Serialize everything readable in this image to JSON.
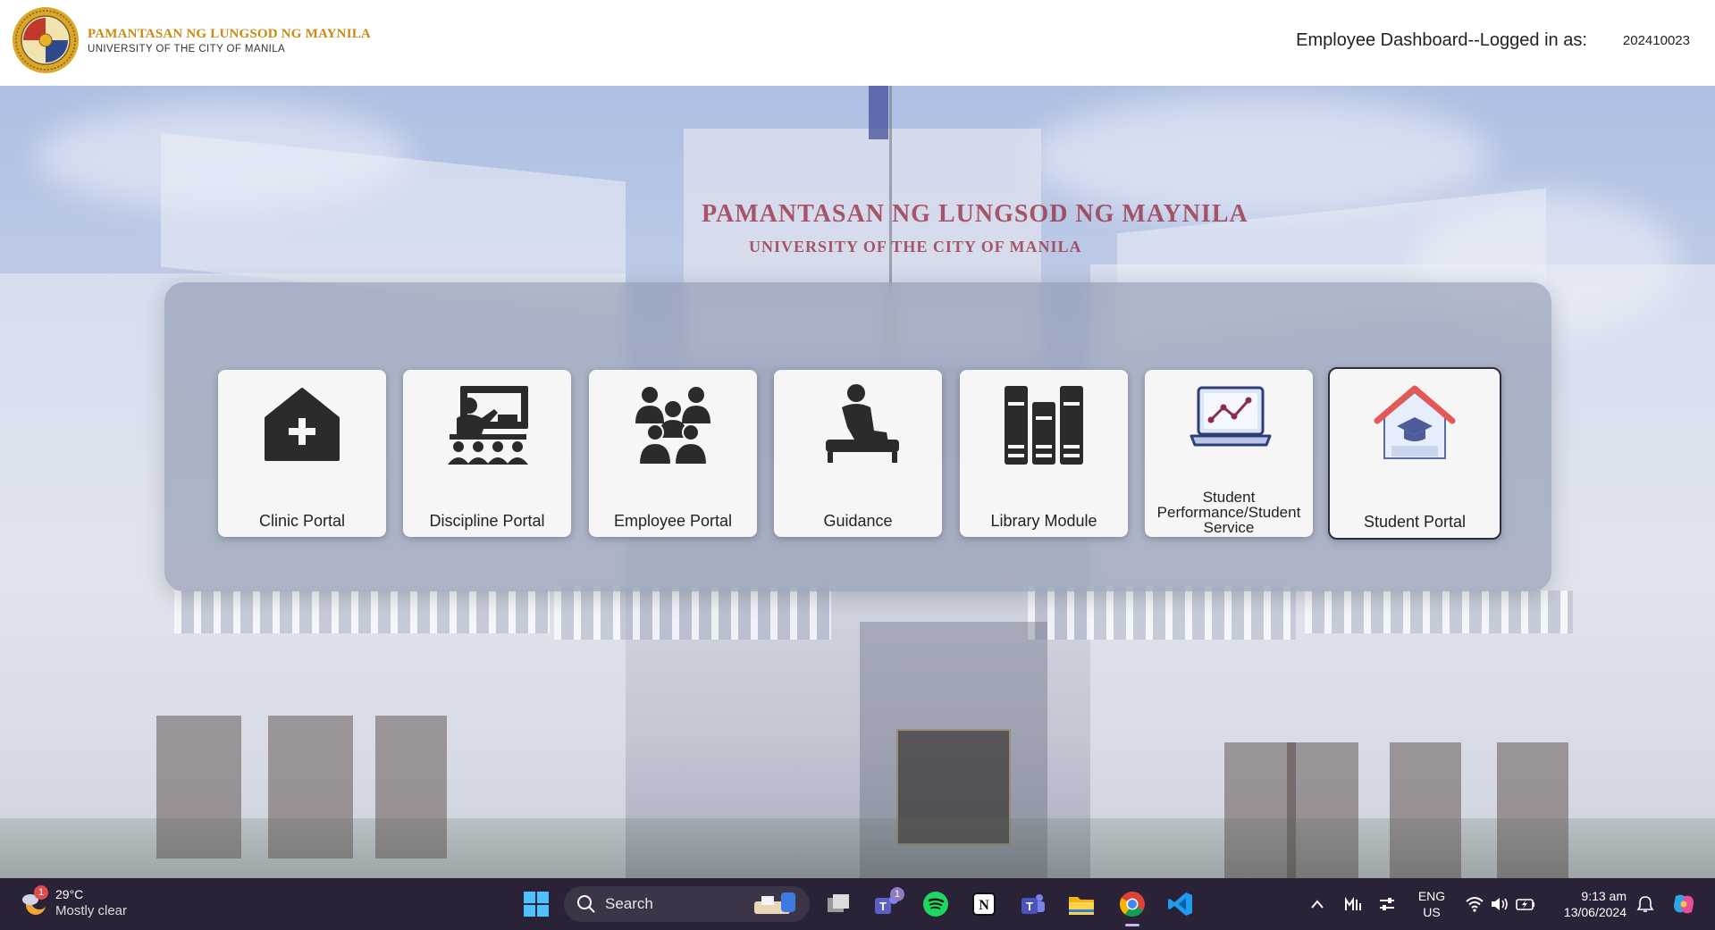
{
  "header": {
    "logo_title": "PAMANTASAN NG LUNGSOD NG MAYNILA",
    "logo_subtitle": "UNIVERSITY OF THE CITY OF MANILA",
    "dashboard_label": "Employee Dashboard--Logged in as:",
    "user_id": "202410023"
  },
  "background": {
    "sign_line1": "PAMANTASAN NG LUNGSOD NG MAYNILA",
    "sign_line2": "UNIVERSITY OF THE CITY OF MANILA"
  },
  "portals": [
    {
      "label": "Clinic Portal",
      "icon": "clinic-house-plus-icon"
    },
    {
      "label": "Discipline Portal",
      "icon": "teacher-classroom-icon"
    },
    {
      "label": "Employee Portal",
      "icon": "people-group-icon"
    },
    {
      "label": "Guidance",
      "icon": "seated-person-icon"
    },
    {
      "label": "Library Module",
      "icon": "books-icon"
    },
    {
      "label": "Student Performance/Student Service",
      "icon": "laptop-chart-icon"
    },
    {
      "label": "Student Portal",
      "icon": "school-house-icon",
      "selected": true
    }
  ],
  "taskbar": {
    "weather_temp": "29°C",
    "weather_cond": "Mostly clear",
    "weather_badge": "1",
    "search_label": "Search",
    "teams_badge": "1",
    "lang_line1": "ENG",
    "lang_line2": "US",
    "time": "9:13 am",
    "date": "13/06/2024",
    "pinned_apps": [
      "windows-start-icon",
      "task-view-icon",
      "teams-icon",
      "spotify-icon",
      "notion-icon",
      "teams-work-icon",
      "file-explorer-icon",
      "chrome-icon",
      "vscode-icon"
    ]
  },
  "colors": {
    "header_bg": "#ffffff",
    "logo_title": "#c88a12",
    "taskbar_bg": "#2a2236",
    "card_bg": "#f6f6f7",
    "icon_dark": "#2b2b2b"
  }
}
